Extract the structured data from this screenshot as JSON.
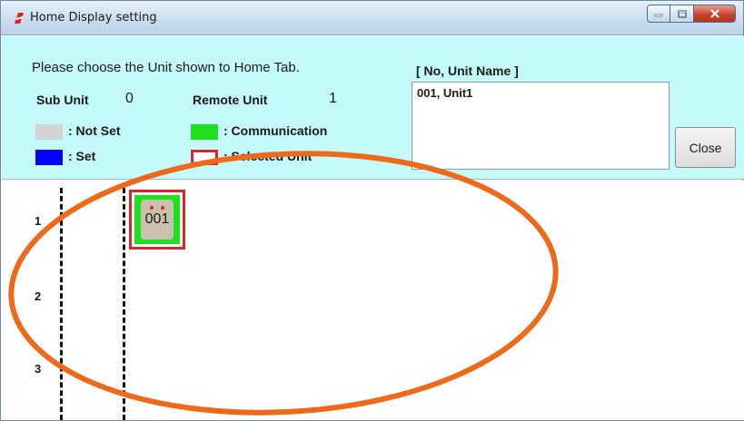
{
  "window": {
    "title": "Home Display setting"
  },
  "panel": {
    "prompt": "Please choose the Unit shown to Home Tab.",
    "sub_unit_label": "Sub Unit",
    "sub_unit_value": "0",
    "remote_unit_label": "Remote Unit",
    "remote_unit_value": "1",
    "legend": {
      "not_set": ": Not Set",
      "set": ": Set",
      "communication": ": Communication",
      "selected_unit": ": Selected Unit"
    },
    "list_header": "[ No, Unit Name ]",
    "list_items": [
      "001, Unit1"
    ],
    "close_label": "Close"
  },
  "grid": {
    "rows": [
      "1",
      "2",
      "3"
    ],
    "unit": {
      "label": "001",
      "row": "1"
    }
  },
  "colors": {
    "panel_bg": "#c5fafa",
    "not_set": "#d3d3d3",
    "set": "#0000ff",
    "communication": "#1fe01f",
    "selected_border": "#e0232d",
    "annotation_ellipse": "#ee6a1a"
  },
  "icons": {
    "app": "app-logo-icon",
    "minimize": "minimize-icon",
    "maximize": "maximize-icon",
    "close": "close-icon"
  }
}
